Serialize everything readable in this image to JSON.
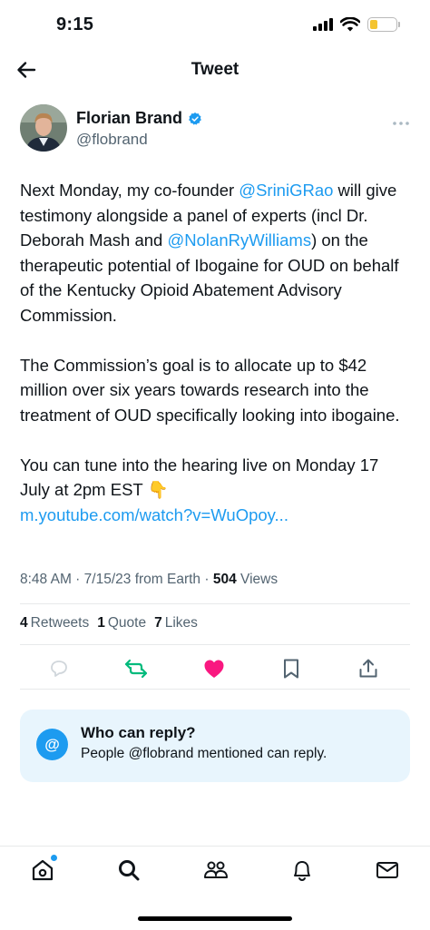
{
  "status_bar": {
    "time": "9:15",
    "battery_level": 0.3
  },
  "header": {
    "title": "Tweet",
    "back_icon": "arrow-left-icon"
  },
  "author": {
    "name": "Florian Brand",
    "handle": "@flobrand",
    "verified": true,
    "more_icon": "more-horizontal-icon"
  },
  "tweet": {
    "p1_part1": "Next Monday, my co-founder ",
    "p1_mention1": "@SriniGRao",
    "p1_part2": " will give testimony alongside a panel of experts (incl Dr. Deborah Mash and ",
    "p1_mention2": "@NolanRyWilliams",
    "p1_part3": ") on the therapeutic potential of Ibogaine for OUD on behalf of the Kentucky Opioid Abatement Advisory Commission.",
    "p2": "The Commission’s goal is to allocate up to $42 million over six years towards research into the treatment of OUD specifically looking into ibogaine.",
    "p3": "You can tune into the hearing live on Monday 17 July at 2pm EST 👇",
    "link": "m.youtube.com/watch?v=WuOpoy..."
  },
  "meta": {
    "time": "8:48 AM",
    "date": "7/15/23",
    "source": "from Earth",
    "views_count": "504",
    "views_label": "Views"
  },
  "stats": {
    "retweets_count": "4",
    "retweets_label": "Retweets",
    "quotes_count": "1",
    "quotes_label": "Quote",
    "likes_count": "7",
    "likes_label": "Likes"
  },
  "actions": {
    "reply_icon": "reply-icon",
    "retweet_icon": "retweet-icon",
    "like_icon": "heart-icon",
    "bookmark_icon": "bookmark-icon",
    "share_icon": "share-icon"
  },
  "reply_settings": {
    "title": "Who can reply?",
    "description": "People @flobrand mentioned can reply.",
    "icon": "@"
  },
  "bottom_nav": {
    "items": [
      "home-icon",
      "search-icon",
      "communities-icon",
      "notifications-icon",
      "messages-icon"
    ]
  },
  "colors": {
    "accent": "#1d9bf0",
    "retweet": "#00ba7c",
    "like": "#f91880",
    "text": "#0f1419",
    "secondary": "#536471"
  }
}
